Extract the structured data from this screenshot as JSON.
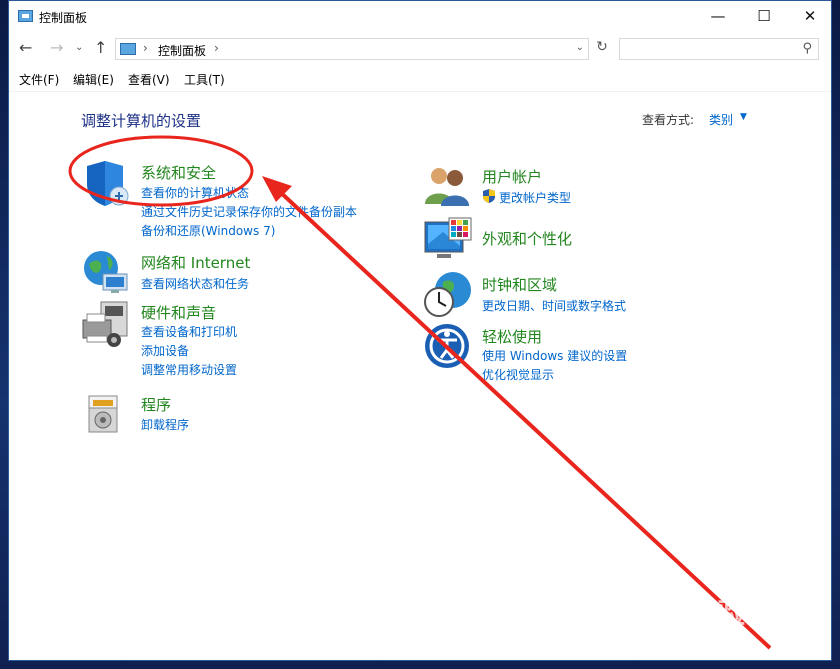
{
  "window": {
    "title": "控制面板",
    "controls": {
      "minimize": "—",
      "maximize": "☐",
      "close": "✕"
    }
  },
  "nav": {
    "back": "←",
    "forward": "→",
    "recent": "⌄",
    "up": "↑",
    "address_separator": "›",
    "address": "控制面板",
    "address_dropdown": "⌄",
    "refresh": "↻",
    "search_placeholder": "",
    "search_icon": "search-icon"
  },
  "menu": {
    "file": "文件(F)",
    "edit": "编辑(E)",
    "view": "查看(V)",
    "tools": "工具(T)"
  },
  "content": {
    "title": "调整计算机的设置",
    "view_by_label": "查看方式:",
    "view_by_value": "类别"
  },
  "categories": {
    "system_security": {
      "title": "系统和安全",
      "links": [
        "查看你的计算机状态",
        "通过文件历史记录保存你的文件备份副本",
        "备份和还原(Windows 7)"
      ]
    },
    "network": {
      "title": "网络和 Internet",
      "links": [
        "查看网络状态和任务"
      ]
    },
    "hardware": {
      "title": "硬件和声音",
      "links": [
        "查看设备和打印机",
        "添加设备",
        "调整常用移动设置"
      ]
    },
    "programs": {
      "title": "程序",
      "links": [
        "卸载程序"
      ]
    },
    "user_accounts": {
      "title": "用户帐户",
      "links": [
        "更改帐户类型"
      ]
    },
    "appearance": {
      "title": "外观和个性化",
      "links": []
    },
    "clock_region": {
      "title": "时钟和区域",
      "links": [
        "更改日期、时间或数字格式"
      ]
    },
    "ease_access": {
      "title": "轻松使用",
      "links": [
        "使用 Windows 建议的设置",
        "优化视觉显示"
      ]
    }
  },
  "annotation": {
    "color": "#e8261e"
  },
  "watermark": {
    "text": "Bai 经验",
    "sub": "jingyan.baidu.com"
  },
  "colors": {
    "category_title": "#22861e",
    "link": "#0066cc",
    "heading": "#1e3287"
  }
}
